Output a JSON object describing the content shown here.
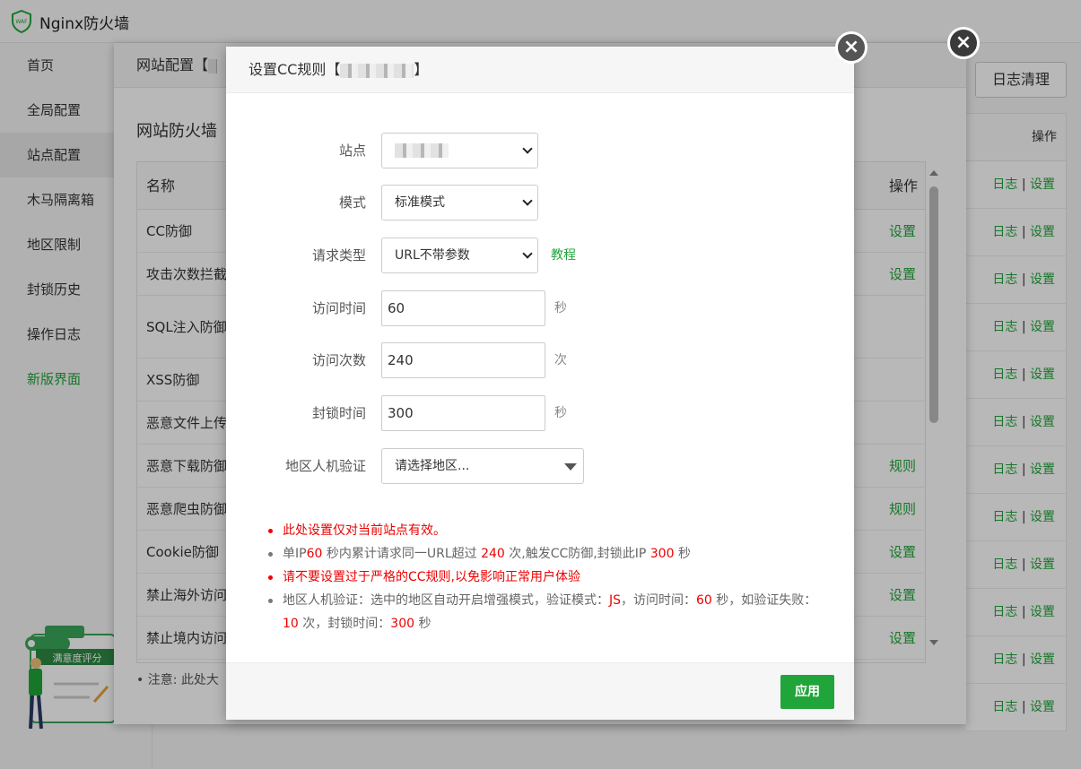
{
  "app": {
    "title": "Nginx防火墙"
  },
  "sidebar": {
    "items": [
      {
        "label": "首页"
      },
      {
        "label": "全局配置"
      },
      {
        "label": "站点配置"
      },
      {
        "label": "木马隔离箱"
      },
      {
        "label": "地区限制"
      },
      {
        "label": "封锁历史"
      },
      {
        "label": "操作日志"
      },
      {
        "label": "新版界面"
      }
    ]
  },
  "rating_widget": {
    "label": "满意度评分"
  },
  "toolbar": {
    "log_clean": "日志清理"
  },
  "background_table": {
    "op_header": "操作",
    "rows": [
      {
        "log": "日志",
        "sep": "|",
        "set": "设置"
      },
      {
        "log": "日志",
        "sep": "|",
        "set": "设置"
      },
      {
        "log": "日志",
        "sep": "|",
        "set": "设置"
      },
      {
        "log": "日志",
        "sep": "|",
        "set": "设置"
      },
      {
        "log": "日志",
        "sep": "|",
        "set": "设置"
      },
      {
        "log": "日志",
        "sep": "|",
        "set": "设置"
      },
      {
        "log": "日志",
        "sep": "|",
        "set": "设置"
      },
      {
        "log": "日志",
        "sep": "|",
        "set": "设置"
      },
      {
        "log": "日志",
        "sep": "|",
        "set": "设置"
      },
      {
        "log": "日志",
        "sep": "|",
        "set": "设置"
      },
      {
        "log": "日志",
        "sep": "|",
        "set": "设置"
      },
      {
        "log": "日志",
        "sep": "|",
        "set": "设置"
      }
    ]
  },
  "site_config": {
    "title": "网站配置【",
    "subtitle": "网站防火墙",
    "col_name": "名称",
    "col_op": "操作",
    "rows": [
      {
        "name": "CC防御",
        "op": "设置"
      },
      {
        "name": "攻击次数拦截",
        "op": "设置"
      },
      {
        "name": "SQL注入防御",
        "op": ""
      },
      {
        "name": "XSS防御",
        "op": ""
      },
      {
        "name": "恶意文件上传",
        "op": ""
      },
      {
        "name": "恶意下载防御",
        "op": "规则"
      },
      {
        "name": "恶意爬虫防御",
        "op": "规则"
      },
      {
        "name": "Cookie防御",
        "op": "设置"
      },
      {
        "name": "禁止海外访问",
        "op": "设置"
      },
      {
        "name": "禁止境内访问",
        "op": "设置"
      }
    ],
    "note": "注意: 此处大"
  },
  "modal": {
    "title": "设置CC规则【",
    "title_end": "】",
    "close": "×",
    "form": {
      "site": {
        "label": "站点"
      },
      "mode": {
        "label": "模式",
        "value": "标准模式"
      },
      "request_type": {
        "label": "请求类型",
        "value": "URL不带参数",
        "link": "教程"
      },
      "visit_time": {
        "label": "访问时间",
        "value": "60",
        "unit": "秒"
      },
      "visit_count": {
        "label": "访问次数",
        "value": "240",
        "unit": "次"
      },
      "block_time": {
        "label": "封锁时间",
        "value": "300",
        "unit": "秒"
      },
      "region_verify": {
        "label": "地区人机验证",
        "placeholder": "请选择地区..."
      }
    },
    "tips": {
      "t1": "此处设置仅对当前站点有效。",
      "t2": {
        "p1": "单IP",
        "v1": "60",
        "p2": " 秒内累计请求同一URL超过 ",
        "v2": "240",
        "p3": " 次,触发CC防御,封锁此IP ",
        "v3": "300",
        "p4": " 秒"
      },
      "t3": "请不要设置过于严格的CC规则,以免影响正常用户体验",
      "t4": {
        "p1": "地区人机验证：选中的地区自动开启增强模式，验证模式：",
        "v1": "JS",
        "p2": "，访问时间：",
        "v2": "60",
        "p3": " 秒，如验证失败：",
        "v3": "10",
        "p4": " 次，封锁时间：",
        "v4": "300",
        "p5": " 秒"
      }
    },
    "apply": "应用"
  }
}
